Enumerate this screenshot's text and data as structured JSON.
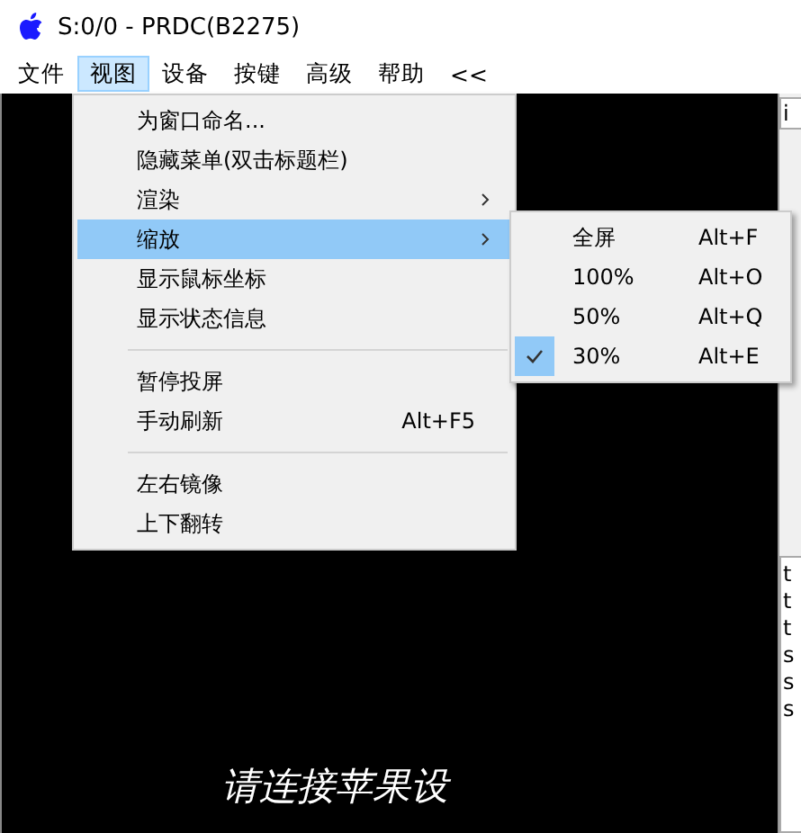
{
  "window": {
    "title": "S:0/0 - PRDC(B2275)"
  },
  "menu_bar": [
    {
      "label": "文件",
      "selected": false
    },
    {
      "label": "视图",
      "selected": true
    },
    {
      "label": "设备",
      "selected": false
    },
    {
      "label": "按键",
      "selected": false
    },
    {
      "label": "高级",
      "selected": false
    },
    {
      "label": "帮助",
      "selected": false
    },
    {
      "label": "<<",
      "selected": false
    }
  ],
  "view_menu": {
    "items": [
      {
        "kind": "item",
        "label": "为窗口命名...",
        "selected": false
      },
      {
        "kind": "item",
        "label": "隐藏菜单(双击标题栏)",
        "selected": false
      },
      {
        "kind": "submenu",
        "label": "渲染",
        "selected": false
      },
      {
        "kind": "submenu",
        "label": "缩放",
        "selected": true
      },
      {
        "kind": "item",
        "label": "显示鼠标坐标",
        "selected": false
      },
      {
        "kind": "item",
        "label": "显示状态信息",
        "selected": false
      },
      {
        "kind": "separator"
      },
      {
        "kind": "item",
        "label": "暂停投屏",
        "selected": false
      },
      {
        "kind": "item",
        "label": "手动刷新",
        "shortcut": "Alt+F5",
        "selected": false
      },
      {
        "kind": "separator"
      },
      {
        "kind": "item",
        "label": "左右镜像",
        "selected": false
      },
      {
        "kind": "item",
        "label": "上下翻转",
        "selected": false
      }
    ]
  },
  "zoom_submenu": {
    "items": [
      {
        "label": "全屏",
        "shortcut": "Alt+F",
        "checked": false
      },
      {
        "label": "100%",
        "shortcut": "Alt+O",
        "checked": false
      },
      {
        "label": "50%",
        "shortcut": "Alt+Q",
        "checked": false
      },
      {
        "label": "30%",
        "shortcut": "Alt+E",
        "checked": true
      }
    ]
  },
  "screen": {
    "message": "请连接苹果设"
  },
  "side_panel": {
    "field_text": "i",
    "log_lines": [
      "t",
      "t",
      "t",
      "s",
      "s",
      "s"
    ]
  }
}
